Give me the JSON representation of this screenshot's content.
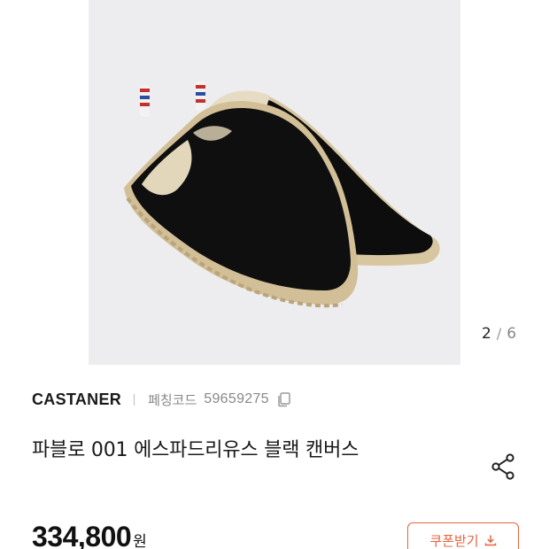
{
  "gallery": {
    "current": "2",
    "separator": "/",
    "total": "6"
  },
  "product": {
    "brand": "CASTANER",
    "code_label": "페칭코드",
    "code_value": "59659275",
    "title": "파블로 001 에스파드리유스 블랙 캔버스",
    "price": "334,800",
    "price_unit": "원"
  },
  "actions": {
    "coupon_label": "쿠폰받기"
  },
  "icons": {
    "copy": "copy-icon",
    "share": "share-icon",
    "download": "download-icon"
  },
  "colors": {
    "accent": "#e7643e",
    "photo_bg": "#ededef"
  }
}
